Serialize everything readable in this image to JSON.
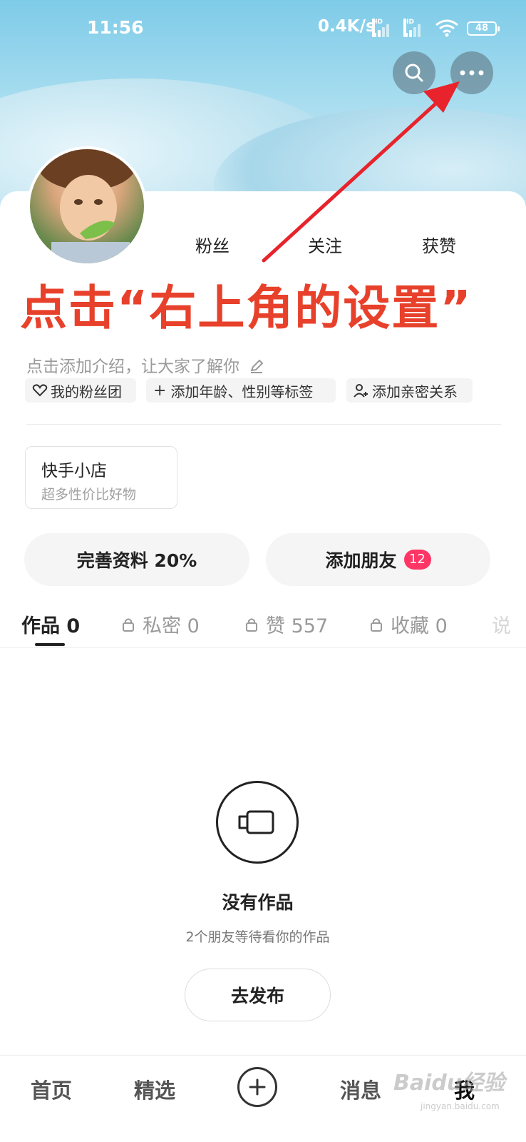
{
  "status_bar": {
    "time": "11:56",
    "net_speed": "0.4K/s",
    "hd_label": "HD",
    "battery": "48"
  },
  "profile": {
    "stats": [
      {
        "label": "粉丝"
      },
      {
        "label": "关注"
      },
      {
        "label": "获赞"
      }
    ],
    "intro_placeholder": "点击添加介绍，让大家了解你",
    "chips": [
      {
        "label": "我的粉丝团",
        "icon": "heart-outline-icon"
      },
      {
        "label": "添加年龄、性别等标签",
        "icon": "plus-icon"
      },
      {
        "label": "添加亲密关系",
        "icon": "person-add-icon"
      }
    ]
  },
  "annotation": {
    "text": "点击“右上角的设置”",
    "color": "#e8412b"
  },
  "shop": {
    "title": "快手小店",
    "subtitle": "超多性价比好物"
  },
  "actions": {
    "complete_profile": "完善资料 20%",
    "add_friends": "添加朋友",
    "add_friends_badge": "12"
  },
  "tabs": [
    {
      "label": "作品 0",
      "active": true,
      "locked": false
    },
    {
      "label": "私密 0",
      "active": false,
      "locked": true
    },
    {
      "label": "赞 557",
      "active": false,
      "locked": true
    },
    {
      "label": "收藏 0",
      "active": false,
      "locked": true
    },
    {
      "label": "说",
      "active": false,
      "locked": false
    }
  ],
  "empty_state": {
    "title": "没有作品",
    "subtitle": "2个朋友等待看你的作品",
    "button": "去发布"
  },
  "bottom_nav": {
    "home": "首页",
    "featured": "精选",
    "messages": "消息",
    "me": "我"
  },
  "watermark": {
    "text": "Baidu经验",
    "sub": "jingyan.baidu.com"
  },
  "colors": {
    "accent_red": "#fe3666",
    "hero_sky": "#7ecbe8"
  }
}
